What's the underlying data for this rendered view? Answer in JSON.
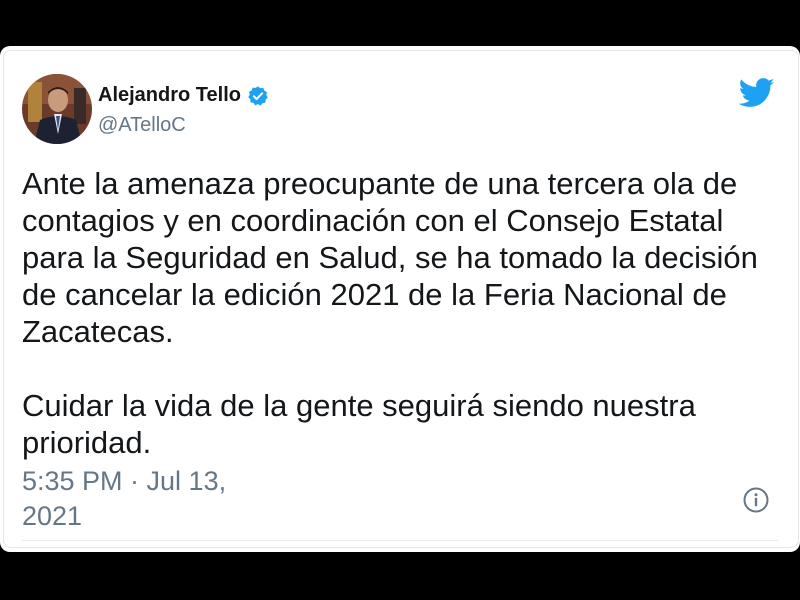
{
  "author": {
    "name": "Alejandro Tello",
    "handle": "@ATelloC",
    "verified": true,
    "avatar": "avatar"
  },
  "tweet": {
    "paragraphs": [
      "Ante la amenaza preocupante de una tercera ola de contagios y en coordinación con el Consejo Estatal para la Seguridad en Salud, se ha tomado la decisión de cancelar la edición 2021 de la Feria Nacional de Zacatecas.",
      "Cuidar la vida de la gente seguirá siendo nuestra prioridad."
    ],
    "timestamp": "5:35 PM · Jul 13, 2021"
  },
  "icons": {
    "brand": "twitter-bird-icon",
    "verified": "verified-badge-icon",
    "info": "info-icon"
  },
  "colors": {
    "brand": "#1da1f2",
    "text": "#14171a",
    "secondary": "#657786"
  }
}
